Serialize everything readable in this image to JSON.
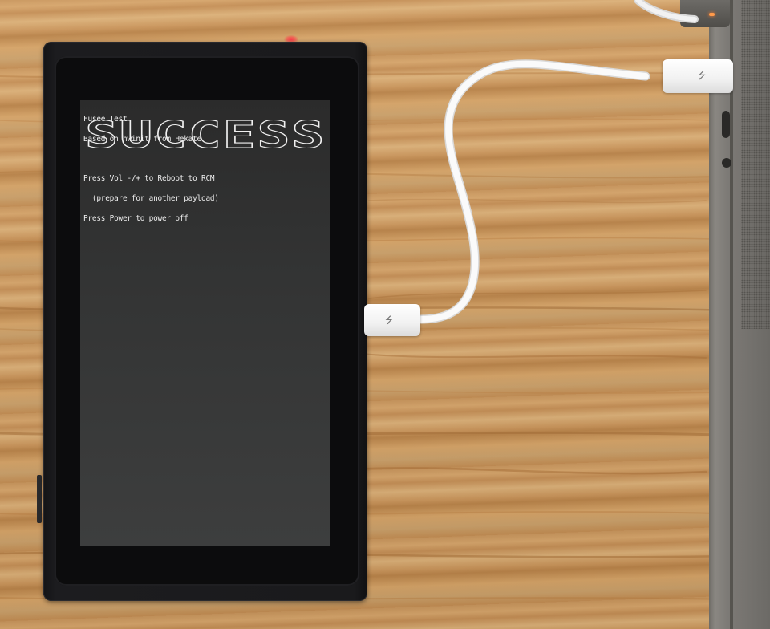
{
  "screen": {
    "lines": [
      "Fusee Test",
      "Based on hwinit from Hekate"
    ],
    "banner_text": "SUCCESS",
    "instructions": [
      "Press Vol -/+ to Reboot to RCM",
      "  (prepare for another payload)",
      "Press Power to power off"
    ]
  },
  "cable": {
    "usb_symbol": "⭍"
  },
  "colors": {
    "screen_text": "#eeeeee",
    "power_led": "#ff3a4a",
    "magsafe_led": "#ff9a4a",
    "cable": "#ffffff"
  },
  "icons": [
    "usb-c-plug-icon",
    "usb-symbol-icon",
    "power-led-icon",
    "magsafe-led-icon"
  ]
}
